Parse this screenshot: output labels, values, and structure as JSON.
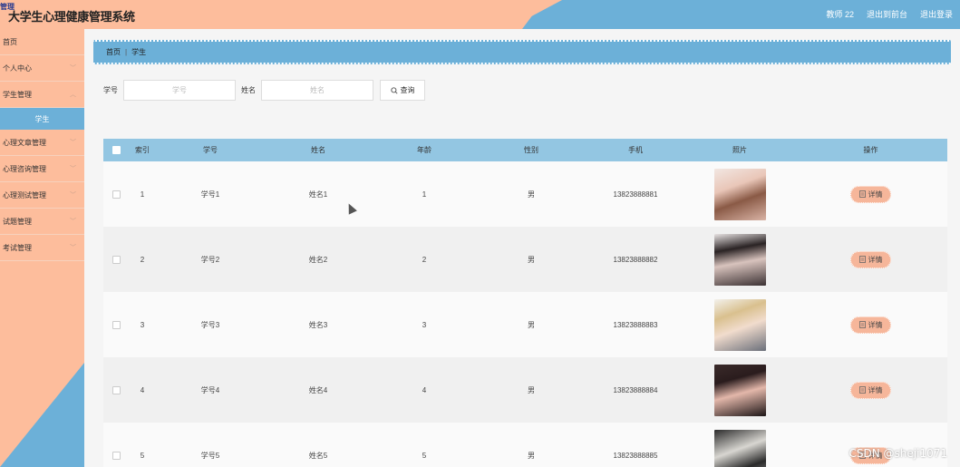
{
  "header": {
    "logo_text": "管理",
    "title": "大学生心理健康管理系统",
    "links": [
      "教师 22",
      "退出到前台",
      "退出登录"
    ]
  },
  "sidebar": {
    "items": [
      {
        "label": "首页",
        "has_arrow": false
      },
      {
        "label": "个人中心",
        "has_arrow": true
      },
      {
        "label": "学生管理",
        "has_arrow": true,
        "sub": "学生"
      },
      {
        "label": "心理文章管理",
        "has_arrow": true
      },
      {
        "label": "心理咨询管理",
        "has_arrow": true
      },
      {
        "label": "心理测试管理",
        "has_arrow": true
      },
      {
        "label": "试题管理",
        "has_arrow": true
      },
      {
        "label": "考试管理",
        "has_arrow": true
      }
    ]
  },
  "breadcrumb": {
    "home": "首页",
    "current": "学生"
  },
  "search": {
    "student_no_label": "学号",
    "student_no_placeholder": "学号",
    "name_label": "姓名",
    "name_placeholder": "姓名",
    "button_label": "查询"
  },
  "table": {
    "headers": [
      "索引",
      "学号",
      "姓名",
      "年龄",
      "性别",
      "手机",
      "照片",
      "操作"
    ],
    "detail_label": "详情",
    "rows": [
      {
        "idx": "1",
        "no": "学号1",
        "name": "姓名1",
        "age": "1",
        "sex": "男",
        "phone": "13823888881",
        "photo": "photo-1"
      },
      {
        "idx": "2",
        "no": "学号2",
        "name": "姓名2",
        "age": "2",
        "sex": "男",
        "phone": "13823888882",
        "photo": "photo-2"
      },
      {
        "idx": "3",
        "no": "学号3",
        "name": "姓名3",
        "age": "3",
        "sex": "男",
        "phone": "13823888883",
        "photo": "photo-3"
      },
      {
        "idx": "4",
        "no": "学号4",
        "name": "姓名4",
        "age": "4",
        "sex": "男",
        "phone": "13823888884",
        "photo": "photo-4"
      },
      {
        "idx": "5",
        "no": "学号5",
        "name": "姓名5",
        "age": "5",
        "sex": "男",
        "phone": "13823888885",
        "photo": "photo-5"
      }
    ]
  },
  "watermark": "CSDN @sheji1071",
  "colors": {
    "peach": "#fdbd9c",
    "blue": "#6cb0d8",
    "table_header": "#93c6e2",
    "detail_btn": "#f6b69a"
  }
}
